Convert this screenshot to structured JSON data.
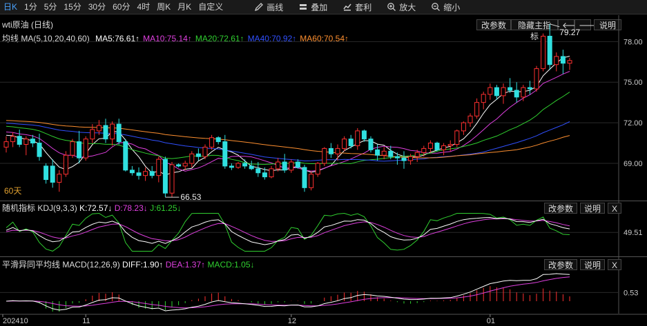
{
  "toolbar": {
    "periods": [
      "日K",
      "1分",
      "5分",
      "15分",
      "30分",
      "60分",
      "4时",
      "周K",
      "月K",
      "自定义"
    ],
    "active": "日K",
    "tools": [
      {
        "icon": "pencil-icon",
        "label": "画线"
      },
      {
        "icon": "layers-icon",
        "label": "叠加"
      },
      {
        "icon": "arbitrage-icon",
        "label": "套利"
      },
      {
        "icon": "zoom-in-icon",
        "label": "放大"
      },
      {
        "icon": "zoom-out-icon",
        "label": "缩小"
      }
    ]
  },
  "main": {
    "title": "wti原油 (日线)",
    "btn_params": "改参数",
    "btn_hide": "隐藏主指标",
    "btn_help": "说明",
    "ma_label": "均线 MA(5,10,20,40,60)",
    "ma": [
      {
        "text": "MA5:76.61↑",
        "color": "#ffffff"
      },
      {
        "text": "MA10:75.14↑",
        "color": "#e040e0"
      },
      {
        "text": "MA20:72.61↑",
        "color": "#30d030"
      },
      {
        "text": "MA40:70.92↑",
        "color": "#3050ff"
      },
      {
        "text": "MA60:70.54↑",
        "color": "#ff9030"
      }
    ],
    "left_label": "60天",
    "high_label": "79.27",
    "low_label": "66.53"
  },
  "kdj": {
    "label": "随机指标 KDJ(9,3,3)",
    "k": "K:72.57↓",
    "d": "D:78.23↓",
    "j": "J:61.25↓",
    "btn_params": "改参数",
    "btn_help": "说明",
    "btn_close": "X",
    "axis": "49.51"
  },
  "macd": {
    "label": "平滑异同平均线 MACD(12,26,9)",
    "diff": "DIFF:1.90↑",
    "dea": "DEA:1.37↑",
    "macd": "MACD:1.05↓",
    "btn_params": "改参数",
    "btn_help": "说明",
    "btn_close": "X",
    "axis": "0.53"
  },
  "colors": {
    "up": "#ff3030",
    "down": "#30e0e0",
    "ma5": "#ffffff",
    "ma10": "#e040e0",
    "ma20": "#30d030",
    "ma40": "#3050ff",
    "ma60": "#ff9030",
    "k": "#ffffff",
    "d": "#e040e0",
    "j": "#30d030"
  },
  "chart_data": [
    {
      "type": "candlestick",
      "title": "wti原油 (日线)",
      "x_tick_labels": [
        "202410",
        "11",
        "12",
        "01"
      ],
      "y_ticks": [
        69.0,
        72.0,
        75.0,
        78.0
      ],
      "ylim": [
        66.3,
        79.8
      ],
      "candles": [
        [
          70.2,
          71.0,
          69.8,
          70.6
        ],
        [
          70.6,
          71.3,
          70.2,
          71.0
        ],
        [
          71.0,
          71.5,
          70.2,
          70.4
        ],
        [
          70.4,
          71.0,
          69.6,
          70.8
        ],
        [
          70.8,
          71.1,
          70.2,
          70.5
        ],
        [
          70.5,
          71.2,
          69.2,
          69.5
        ],
        [
          68.8,
          69.0,
          67.5,
          67.8
        ],
        [
          68.8,
          69.3,
          67.2,
          67.6
        ],
        [
          67.6,
          68.5,
          66.9,
          68.2
        ],
        [
          68.2,
          69.9,
          68.0,
          69.6
        ],
        [
          69.6,
          70.8,
          69.4,
          70.6
        ],
        [
          70.6,
          71.4,
          69.0,
          69.4
        ],
        [
          69.4,
          71.0,
          69.2,
          70.8
        ],
        [
          70.8,
          71.9,
          70.5,
          71.5
        ],
        [
          71.4,
          72.2,
          71.1,
          71.8
        ],
        [
          71.8,
          72.3,
          70.5,
          70.8
        ],
        [
          70.8,
          72.1,
          70.3,
          71.9
        ],
        [
          71.9,
          72.3,
          70.4,
          70.6
        ],
        [
          70.6,
          70.8,
          68.4,
          68.5
        ],
        [
          68.5,
          68.8,
          68.1,
          68.3
        ],
        [
          68.3,
          68.7,
          67.8,
          68.1
        ],
        [
          68.1,
          68.7,
          67.7,
          68.4
        ],
        [
          68.4,
          68.8,
          67.9,
          68.1
        ],
        [
          68.1,
          69.5,
          67.6,
          69.3
        ],
        [
          69.3,
          69.5,
          66.5,
          66.8
        ],
        [
          66.8,
          69.1,
          66.5,
          68.9
        ],
        [
          68.9,
          69.0,
          68.7,
          68.8
        ],
        [
          68.8,
          69.2,
          68.5,
          69.0
        ],
        [
          69.0,
          69.9,
          68.7,
          69.7
        ],
        [
          69.7,
          70.1,
          69.2,
          69.5
        ],
        [
          69.5,
          70.4,
          69.3,
          70.2
        ],
        [
          70.2,
          71.1,
          70.0,
          70.9
        ],
        [
          70.9,
          71.0,
          70.4,
          70.6
        ],
        [
          70.6,
          71.1,
          68.6,
          68.8
        ],
        [
          68.8,
          69.0,
          68.5,
          68.7
        ],
        [
          68.7,
          69.1,
          68.6,
          69.0
        ],
        [
          69.0,
          69.3,
          68.6,
          68.8
        ],
        [
          68.8,
          69.2,
          68.5,
          68.6
        ],
        [
          68.6,
          69.1,
          68.0,
          68.3
        ],
        [
          68.3,
          68.7,
          67.8,
          68.0
        ],
        [
          68.0,
          68.8,
          67.9,
          68.6
        ],
        [
          68.6,
          69.4,
          68.4,
          69.1
        ],
        [
          69.1,
          69.7,
          68.3,
          68.5
        ],
        [
          68.5,
          69.3,
          68.3,
          69.1
        ],
        [
          69.1,
          69.3,
          68.6,
          68.7
        ],
        [
          68.7,
          68.9,
          66.9,
          67.2
        ],
        [
          67.2,
          68.4,
          67.0,
          68.2
        ],
        [
          68.2,
          69.1,
          68.0,
          69.0
        ],
        [
          69.0,
          70.2,
          68.8,
          70.1
        ],
        [
          70.1,
          70.5,
          69.4,
          69.7
        ],
        [
          69.7,
          70.4,
          69.2,
          70.1
        ],
        [
          70.1,
          71.0,
          69.9,
          70.8
        ],
        [
          70.8,
          71.1,
          70.1,
          70.3
        ],
        [
          70.3,
          71.6,
          70.0,
          71.4
        ],
        [
          71.4,
          71.5,
          70.6,
          70.8
        ],
        [
          70.8,
          71.0,
          69.8,
          70.0
        ],
        [
          70.0,
          70.4,
          69.2,
          69.6
        ],
        [
          69.6,
          70.2,
          69.3,
          69.9
        ],
        [
          69.9,
          70.3,
          69.3,
          69.5
        ],
        [
          69.5,
          69.8,
          68.9,
          69.4
        ],
        [
          69.4,
          69.9,
          68.6,
          69.2
        ],
        [
          69.2,
          69.7,
          68.9,
          69.5
        ],
        [
          69.5,
          70.0,
          69.1,
          69.8
        ],
        [
          69.8,
          70.3,
          69.5,
          70.1
        ],
        [
          70.1,
          70.7,
          69.8,
          70.5
        ],
        [
          70.5,
          70.6,
          69.9,
          70.0
        ],
        [
          70.0,
          70.5,
          69.6,
          70.3
        ],
        [
          70.3,
          70.7,
          69.9,
          70.4
        ],
        [
          70.4,
          71.5,
          70.2,
          71.4
        ],
        [
          71.4,
          72.1,
          71.1,
          72.0
        ],
        [
          72.0,
          72.7,
          71.7,
          72.5
        ],
        [
          72.5,
          73.8,
          72.3,
          73.5
        ],
        [
          73.5,
          74.3,
          73.0,
          74.1
        ],
        [
          74.1,
          74.9,
          73.7,
          74.6
        ],
        [
          74.6,
          74.8,
          73.7,
          74.0
        ],
        [
          74.0,
          74.9,
          73.4,
          74.6
        ],
        [
          74.6,
          75.3,
          74.2,
          74.4
        ],
        [
          74.4,
          75.0,
          73.5,
          73.9
        ],
        [
          73.9,
          74.8,
          73.6,
          74.6
        ],
        [
          74.6,
          75.1,
          74.1,
          74.5
        ],
        [
          74.5,
          76.2,
          74.3,
          76.0
        ],
        [
          76.0,
          78.6,
          75.8,
          78.4
        ],
        [
          78.4,
          79.3,
          75.9,
          76.3
        ],
        [
          76.3,
          77.2,
          75.8,
          76.9
        ],
        [
          76.9,
          77.4,
          75.6,
          76.4
        ],
        [
          76.4,
          76.8,
          75.9,
          76.6
        ]
      ],
      "series": [
        {
          "name": "MA5"
        },
        {
          "name": "MA10"
        },
        {
          "name": "MA20"
        },
        {
          "name": "MA40"
        },
        {
          "name": "MA60"
        }
      ],
      "annotations": [
        "79.27",
        "66.53",
        "60天"
      ]
    },
    {
      "type": "line",
      "title": "随机指标 KDJ(9,3,3)",
      "y_ticks": [
        49.51
      ],
      "series": [
        {
          "name": "K"
        },
        {
          "name": "D"
        },
        {
          "name": "J"
        }
      ],
      "last": {
        "K": 72.57,
        "D": 78.23,
        "J": 61.25
      }
    },
    {
      "type": "bar",
      "title": "平滑异同平均线 MACD(12,26,9)",
      "y_ticks": [
        0.53
      ],
      "series": [
        {
          "name": "DIFF"
        },
        {
          "name": "DEA"
        },
        {
          "name": "MACD"
        }
      ],
      "last": {
        "DIFF": 1.9,
        "DEA": 1.37,
        "MACD": 1.05
      }
    }
  ]
}
